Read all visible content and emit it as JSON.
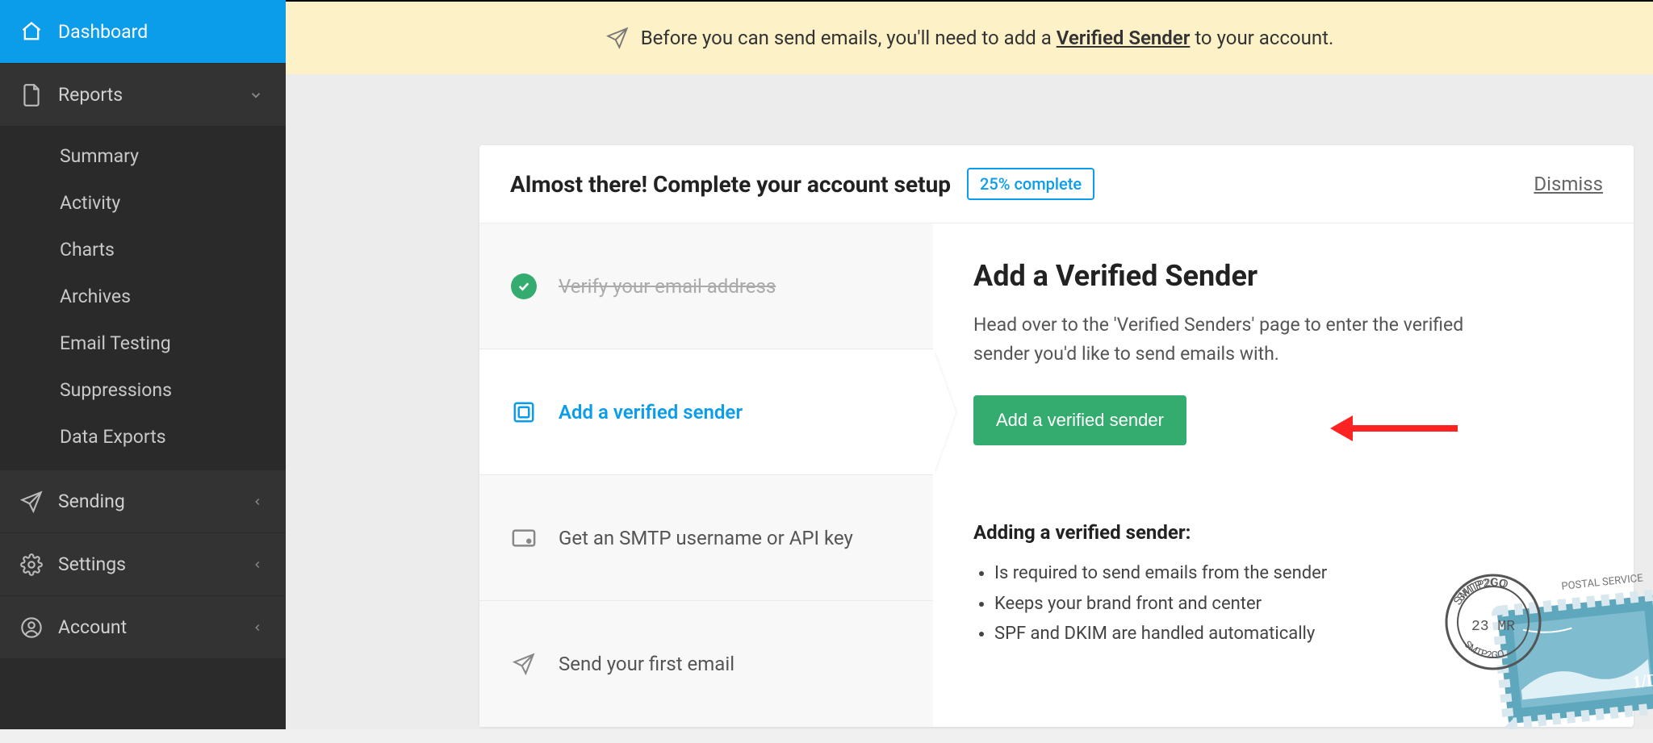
{
  "sidebar": {
    "dashboard": "Dashboard",
    "reports": "Reports",
    "reports_items": [
      "Summary",
      "Activity",
      "Charts",
      "Archives",
      "Email Testing",
      "Suppressions",
      "Data Exports"
    ],
    "sending": "Sending",
    "settings": "Settings",
    "account": "Account"
  },
  "notice": {
    "prefix": "Before you can send emails, you'll need to add a ",
    "link": "Verified Sender",
    "suffix": " to your account."
  },
  "card": {
    "title": "Almost there! Complete your account setup",
    "progress": "25% complete",
    "dismiss": "Dismiss"
  },
  "steps": [
    {
      "label": "Verify your email address"
    },
    {
      "label": "Add a verified sender"
    },
    {
      "label": "Get an SMTP username or API key"
    },
    {
      "label": "Send your first email"
    }
  ],
  "detail": {
    "heading": "Add a Verified Sender",
    "body": "Head over to the 'Verified Senders' page to enter the verified sender you'd like to send emails with.",
    "cta": "Add a verified sender",
    "sub_heading": "Adding a verified sender:",
    "bullets": [
      "Is required to send emails from the sender",
      "Keeps your brand front and center",
      "SPF and DKIM are handled automatically"
    ]
  }
}
